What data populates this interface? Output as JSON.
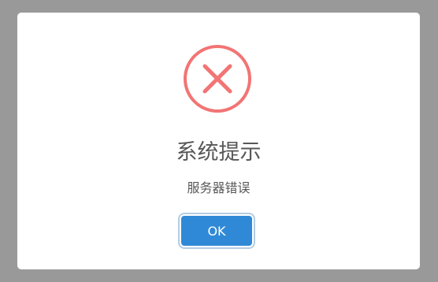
{
  "dialog": {
    "icon": "error-x-icon",
    "title": "系统提示",
    "message": "服务器错误",
    "ok_label": "OK"
  },
  "colors": {
    "backdrop": "#999999",
    "error_icon": "#f27474",
    "button": "#3089d6",
    "text": "#575757"
  }
}
